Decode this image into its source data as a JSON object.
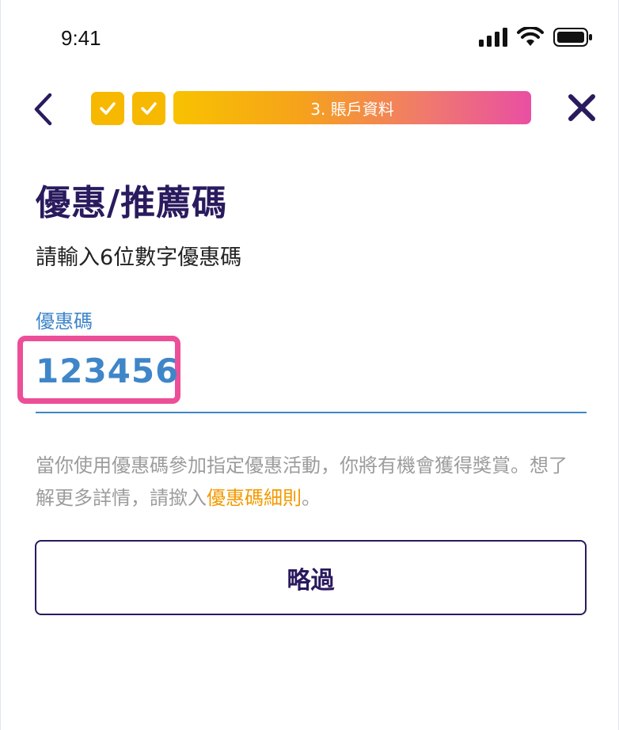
{
  "status_bar": {
    "time": "9:41",
    "icons": [
      "cellular-signal-icon",
      "wifi-icon",
      "battery-icon"
    ]
  },
  "header": {
    "back_icon": "chevron-left-icon",
    "completed_steps": 2,
    "current_step_label": "3. 賬戶資料",
    "close_icon": "close-icon",
    "colors": {
      "step_done": "#f7b800",
      "gradient_start": "#f8c200",
      "gradient_end": "#e94fa3"
    }
  },
  "main": {
    "title": "優惠/推薦碼",
    "subtitle": "請輸入6位數字優惠碼",
    "field": {
      "label": "優惠碼",
      "value": "123456"
    },
    "helper": {
      "text_before": "當你使用優惠碼參加指定優惠活動，你將有機會獲得獎賞。想了解更多詳情，請撳入",
      "link": "優惠碼細則",
      "text_after": "。"
    },
    "skip_label": "略過"
  },
  "colors": {
    "primary": "#2a1a5e",
    "accent_blue": "#3f86c9",
    "highlight": "#ec4f98",
    "link": "#f29a00",
    "helper_text": "#9c9c9c"
  }
}
